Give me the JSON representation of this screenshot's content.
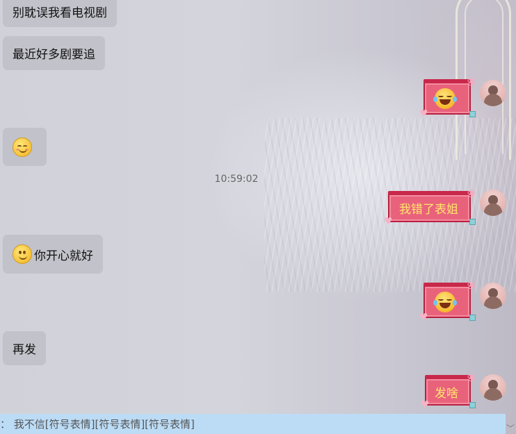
{
  "messages_left": [
    {
      "text": "别耽误我看电视剧"
    },
    {
      "text": "最近好多剧要追"
    },
    {
      "emoji": "relieved-face"
    },
    {
      "emoji": "smiling-face",
      "text": "你开心就好"
    },
    {
      "text": "再发"
    }
  ],
  "timestamp": "10:59:02",
  "messages_right": [
    {
      "emoji": "tears-of-joy-face"
    },
    {
      "text": "我错了表姐"
    },
    {
      "emoji": "tears-of-joy-face"
    },
    {
      "text": "发啥"
    }
  ],
  "input": {
    "text": "：  我不信[符号表情][符号表情][符号表情]"
  },
  "colors": {
    "left_bubble": "#c2c2ca",
    "gift_bubble": "#e9627c",
    "gift_text": "#ffe66b",
    "input_bar": "#bcdcf6"
  }
}
